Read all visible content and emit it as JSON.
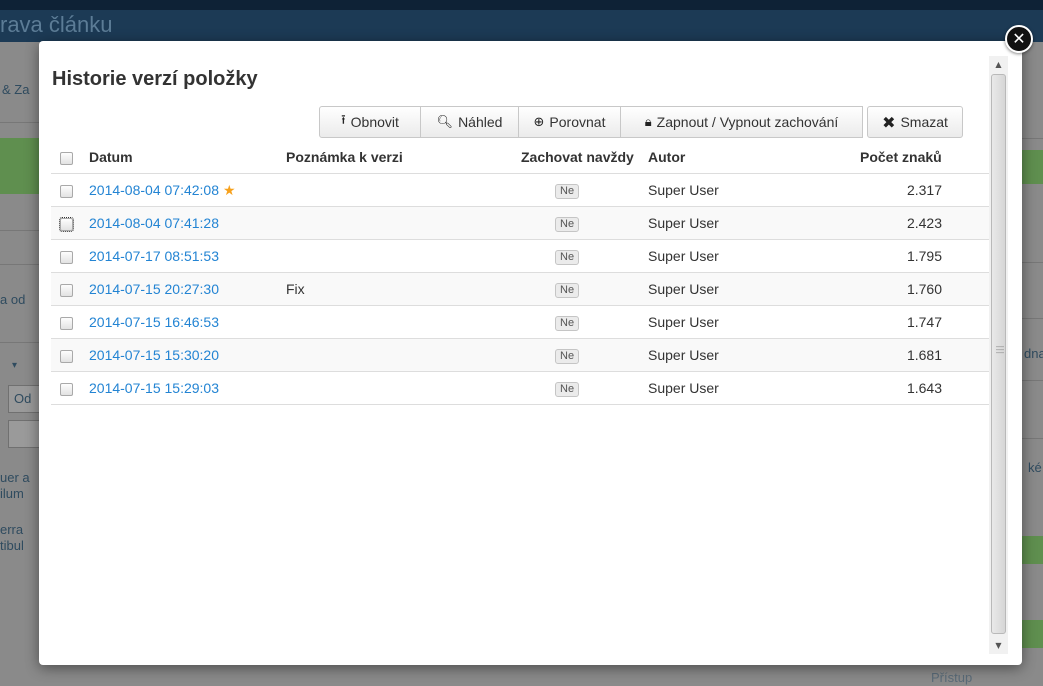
{
  "background": {
    "title_fragment": "rava článku",
    "tab_fragment": "& Za",
    "link_fragment": "a od",
    "dropdown_fragment": "Od",
    "text1": "uer a",
    "text2": "ilum",
    "text3": "erra",
    "text4": "tibul",
    "right1": "dna",
    "right2": "ké",
    "right_bottom": "Přístup"
  },
  "modal": {
    "title": "Historie verzí položky",
    "close_glyph": "✕"
  },
  "toolbar": {
    "restore": {
      "label": "Obnovit",
      "icon": "upload-icon"
    },
    "preview": {
      "label": "Náhled",
      "icon": "search-icon"
    },
    "compare": {
      "label": "Porovnat",
      "icon": "zoom-in-icon"
    },
    "keep": {
      "label": "Zapnout / Vypnout zachování",
      "icon": "lock-icon"
    },
    "delete": {
      "label": "Smazat",
      "icon": "delete-icon"
    }
  },
  "table": {
    "columns": {
      "date": "Datum",
      "note": "Poznámka k verzi",
      "keep": "Zachovat navždy",
      "author": "Autor",
      "count": "Počet znaků"
    },
    "rows": [
      {
        "date": "2014-08-04 07:42:08",
        "note": "",
        "keep": "Ne",
        "author": "Super User",
        "count": "2.317",
        "starred": true
      },
      {
        "date": "2014-08-04 07:41:28",
        "note": "",
        "keep": "Ne",
        "author": "Super User",
        "count": "2.423",
        "starred": false
      },
      {
        "date": "2014-07-17 08:51:53",
        "note": "",
        "keep": "Ne",
        "author": "Super User",
        "count": "1.795",
        "starred": false
      },
      {
        "date": "2014-07-15 20:27:30",
        "note": "Fix",
        "keep": "Ne",
        "author": "Super User",
        "count": "1.760",
        "starred": false
      },
      {
        "date": "2014-07-15 16:46:53",
        "note": "",
        "keep": "Ne",
        "author": "Super User",
        "count": "1.747",
        "starred": false
      },
      {
        "date": "2014-07-15 15:30:20",
        "note": "",
        "keep": "Ne",
        "author": "Super User",
        "count": "1.681",
        "starred": false
      },
      {
        "date": "2014-07-15 15:29:03",
        "note": "",
        "keep": "Ne",
        "author": "Super User",
        "count": "1.643",
        "starred": false
      }
    ]
  },
  "colors": {
    "link": "#2384d3",
    "star": "#f7a11c",
    "overlay": "#7a7a7a",
    "header_bar": "#1c3a55"
  }
}
